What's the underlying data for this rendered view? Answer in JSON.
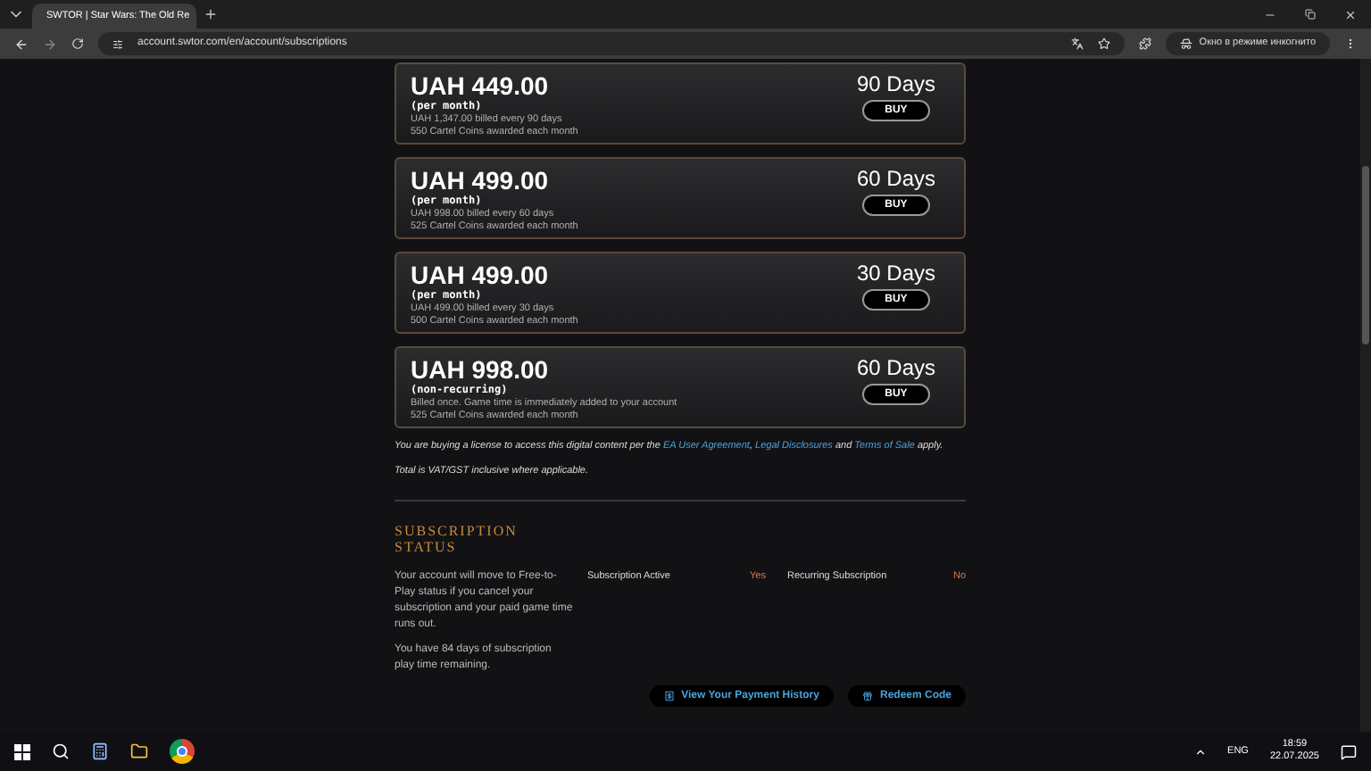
{
  "browser": {
    "tab_title": "SWTOR | Star Wars: The Old Re",
    "url": "account.swtor.com/en/account/subscriptions",
    "incognito_label": "Окно в режиме инкогнито"
  },
  "plans": [
    {
      "price": "UAH 449.00",
      "term": "(per month)",
      "lines": [
        "UAH 1,347.00 billed every 90 days",
        "550 Cartel Coins awarded each month"
      ],
      "duration": "90 Days",
      "button": "BUY"
    },
    {
      "price": "UAH 499.00",
      "term": "(per month)",
      "lines": [
        "UAH 998.00 billed every 60 days",
        "525 Cartel Coins awarded each month"
      ],
      "duration": "60 Days",
      "button": "BUY"
    },
    {
      "price": "UAH 499.00",
      "term": "(per month)",
      "lines": [
        "UAH 499.00 billed every 30 days",
        "500 Cartel Coins awarded each month"
      ],
      "duration": "30 Days",
      "button": "BUY"
    },
    {
      "price": "UAH 998.00",
      "term": "(non-recurring)",
      "lines": [
        "Billed once. Game time is immediately added to your account",
        "525 Cartel Coins awarded each month"
      ],
      "duration": "60 Days",
      "button": "BUY"
    }
  ],
  "legal": {
    "before": "You are buying a license to access this digital content per the",
    "links": [
      "EA User Agreement",
      ", ",
      "Legal Disclosures",
      " and ",
      "Terms of Sale"
    ],
    "after": "apply."
  },
  "vat_note": "Total is VAT/GST inclusive where applicable.",
  "status": {
    "title": "SUBSCRIPTION STATUS",
    "paragraphs": [
      "Your account will move to Free-to-Play status if you cancel your subscription and your paid game time runs out.",
      "You have 84 days of subscription play time remaining."
    ],
    "fields": [
      {
        "label": "Subscription Active",
        "value": "Yes"
      },
      {
        "label": "Recurring Subscription",
        "value": "No"
      }
    ],
    "buttons": [
      {
        "kind": "history",
        "label": "View Your Payment History"
      },
      {
        "kind": "redeem",
        "label": "Redeem Code"
      }
    ]
  },
  "taskbar": {
    "language": "ENG",
    "time": "18:59",
    "date": "22.07.2025"
  }
}
